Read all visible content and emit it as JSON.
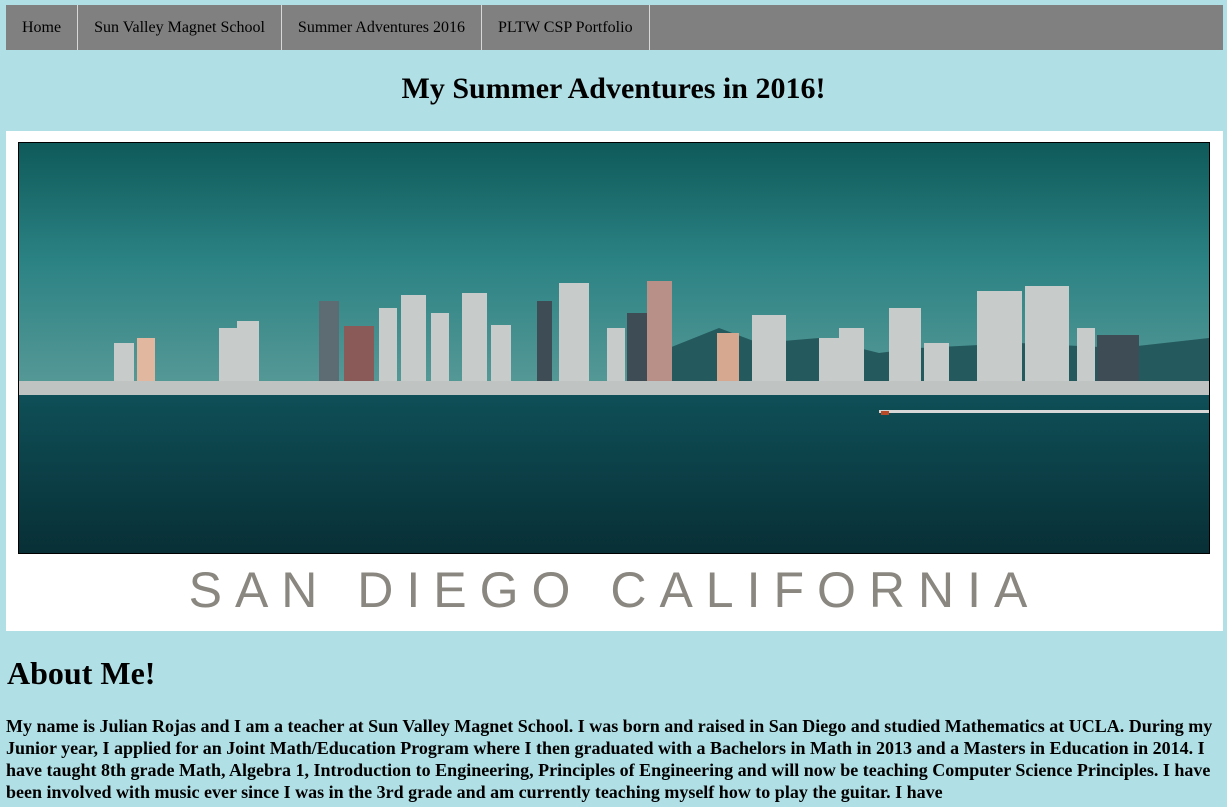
{
  "nav": {
    "items": [
      {
        "label": "Home"
      },
      {
        "label": "Sun Valley Magnet School"
      },
      {
        "label": "Summer Adventures 2016"
      },
      {
        "label": "PLTW CSP Portfolio"
      }
    ]
  },
  "page": {
    "title": "My Summer Adventures in 2016!"
  },
  "banner": {
    "caption": "SAN DIEGO CALIFORNIA"
  },
  "about": {
    "heading": "About Me!",
    "text": "My name is Julian Rojas and I am a teacher at Sun Valley Magnet School. I was born and raised in San Diego and studied Mathematics at UCLA. During my Junior year, I applied for an Joint Math/Education Program where I then graduated with a Bachelors in Math in 2013 and a Masters in Education in 2014. I have taught 8th grade Math, Algebra 1, Introduction to Engineering, Principles of Engineering and will now be teaching Computer Science Principles. I have been involved with music ever since I was in the 3rd grade and am currently teaching myself how to play the guitar. I have"
  }
}
